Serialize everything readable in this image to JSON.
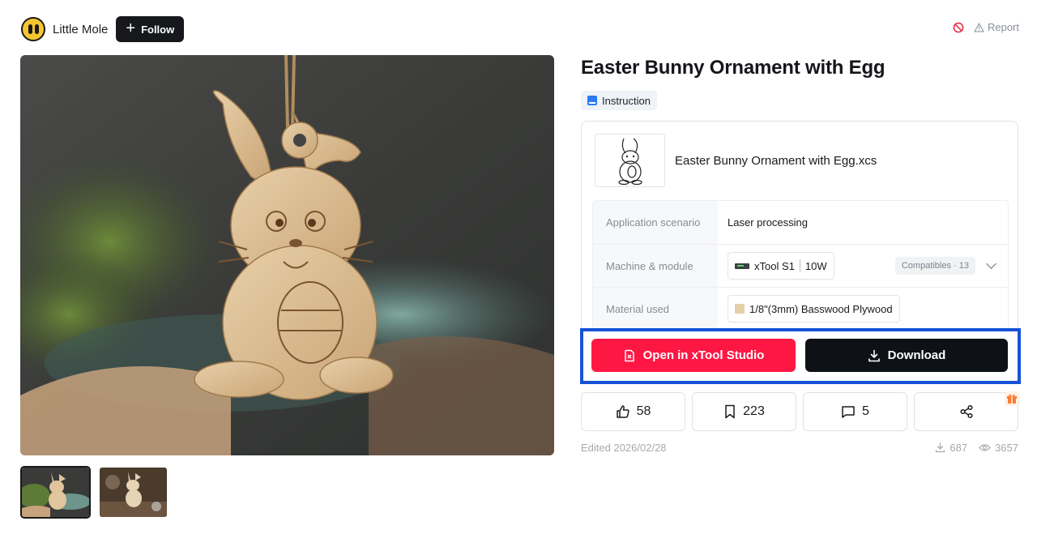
{
  "author": {
    "name": "Little Mole",
    "follow_label": "Follow"
  },
  "top_actions": {
    "report_label": "Report"
  },
  "design": {
    "title": "Easter Bunny Ornament with Egg",
    "tag_label": "Instruction",
    "file_name": "Easter Bunny Ornament with Egg.xcs"
  },
  "specs": {
    "application_label": "Application scenario",
    "application_value": "Laser processing",
    "machine_label": "Machine & module",
    "machine_name": "xTool S1",
    "machine_module": "10W",
    "compatibles": "Compatibles · 13",
    "material_label": "Material used",
    "material_value": "1/8\"(3mm) Basswood Plywood"
  },
  "actions": {
    "open_label": "Open in xTool Studio",
    "download_label": "Download"
  },
  "stats": {
    "likes": "58",
    "bookmarks": "223",
    "comments": "5"
  },
  "meta": {
    "edited": "Edited 2026/02/28",
    "downloads": "687",
    "views": "3657"
  },
  "colors": {
    "accent_red": "#ff1744",
    "dark_button": "#0e1116",
    "highlight_blue": "#1553d6"
  }
}
